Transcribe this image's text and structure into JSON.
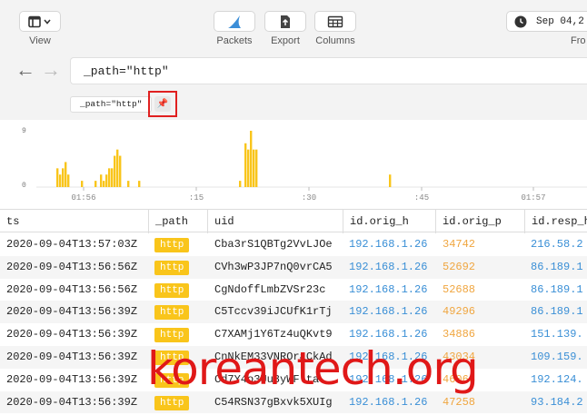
{
  "toolbar": {
    "view_label": "View",
    "packets_label": "Packets",
    "export_label": "Export",
    "columns_label": "Columns",
    "date_text": "Sep 04,2",
    "from_label": "Fro"
  },
  "search": {
    "query": "_path=\"http\""
  },
  "pill": {
    "text": "_path=\"http\""
  },
  "chart_data": {
    "type": "bar",
    "y_ticks": [
      "9",
      "0"
    ],
    "x_ticks": [
      "01:56",
      ":15",
      ":30",
      ":45",
      "01:57"
    ],
    "values": [
      0,
      3,
      2,
      3,
      4,
      2,
      0,
      0,
      0,
      0,
      1,
      0,
      0,
      0,
      0,
      1,
      0,
      2,
      1,
      2,
      3,
      3,
      5,
      6,
      5,
      0,
      0,
      1,
      0,
      0,
      0,
      1,
      0,
      0,
      0,
      0,
      0,
      0,
      0,
      0,
      0,
      0,
      0,
      0,
      0,
      0,
      0,
      0,
      0,
      0,
      0,
      0,
      0,
      0,
      0,
      0,
      0,
      0,
      0,
      0,
      0,
      0,
      0,
      0,
      0,
      0,
      0,
      0,
      1,
      0,
      7,
      6,
      9,
      6,
      6,
      0,
      0,
      0,
      0,
      0,
      0,
      0,
      0,
      0,
      0,
      0,
      0,
      0,
      0,
      0,
      0,
      0,
      0,
      0,
      0,
      0,
      0,
      0,
      0,
      0,
      0,
      0,
      0,
      0,
      0,
      0,
      0,
      0,
      0,
      0,
      0,
      0,
      0,
      0,
      0,
      0,
      0,
      0,
      0,
      0,
      0,
      0,
      0,
      2,
      0,
      0,
      0,
      0,
      0,
      0,
      0,
      0,
      0,
      0,
      0,
      0,
      0,
      0,
      0,
      0,
      0,
      0,
      0,
      0,
      0,
      0,
      0,
      0,
      0,
      0,
      0,
      0,
      0,
      0,
      0,
      0,
      0,
      0,
      0,
      0,
      0,
      0,
      0,
      0,
      0,
      0,
      0,
      0,
      0,
      0,
      0,
      0,
      0,
      0,
      0,
      0,
      0,
      0,
      0,
      0
    ],
    "ylim": [
      0,
      9
    ],
    "color": "#f9c51b"
  },
  "table": {
    "columns": [
      "ts",
      "_path",
      "uid",
      "id.orig_h",
      "id.orig_p",
      "id.resp_h"
    ],
    "rows": [
      [
        "2020-09-04T13:57:03Z",
        "http",
        "Cba3rS1QBTg2VvLJOe",
        "192.168.1.26",
        "34742",
        "216.58.2"
      ],
      [
        "2020-09-04T13:56:56Z",
        "http",
        "CVh3wP3JP7nQ0vrCA5",
        "192.168.1.26",
        "52692",
        "86.189.1"
      ],
      [
        "2020-09-04T13:56:56Z",
        "http",
        "CgNdoffLmbZVSr23c",
        "192.168.1.26",
        "52688",
        "86.189.1"
      ],
      [
        "2020-09-04T13:56:39Z",
        "http",
        "C5Tccv39iJCUfK1rTj",
        "192.168.1.26",
        "49296",
        "86.189.1"
      ],
      [
        "2020-09-04T13:56:39Z",
        "http",
        "C7XAMj1Y6Tz4uQKvt9",
        "192.168.1.26",
        "34886",
        "151.139."
      ],
      [
        "2020-09-04T13:56:39Z",
        "http",
        "CnNkEM33VNROraCkAd",
        "192.168.1.26",
        "43034",
        "109.159."
      ],
      [
        "2020-09-04T13:56:39Z",
        "http",
        "Cd7Y4o3Uu8yWFlta",
        "192.168.1.26",
        "46066",
        "192.124."
      ],
      [
        "2020-09-04T13:56:39Z",
        "http",
        "C54RSN37gBxvk5XUIg",
        "192.168.1.26",
        "47258",
        "93.184.2"
      ]
    ]
  },
  "watermark": {
    "text": "koreantech.org"
  }
}
